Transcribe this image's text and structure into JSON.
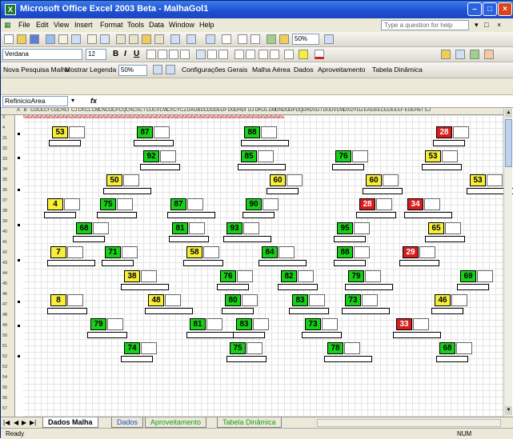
{
  "window": {
    "title": "Microsoft Office Excel 2003 Beta - MalhaGol1",
    "app_icon_label": "X"
  },
  "menu": {
    "items": [
      "File",
      "Edit",
      "View",
      "Insert",
      "Format",
      "Tools",
      "Data",
      "Window",
      "Help"
    ],
    "help_placeholder": "Type a question for help"
  },
  "standard_toolbar": {
    "zoom": "50%"
  },
  "formatting_toolbar": {
    "font": "Verdana",
    "size": "12",
    "bold": "B",
    "italic": "I",
    "underline": "U"
  },
  "custom_toolbar": {
    "items": [
      "Nova Pesquisa Malha",
      "Mostrar Legenda",
      "Configurações Gerais",
      "Malha Aérea",
      "Dados",
      "Aproveitamento",
      "Tabela Dinâmica"
    ],
    "zoom": "50%"
  },
  "formula_bar": {
    "name_box": "RefinicioArea",
    "fx": "fx",
    "content": ""
  },
  "row_numbers": [
    "3",
    "4",
    "31",
    "32",
    "33",
    "34",
    "35",
    "36",
    "37",
    "38",
    "39",
    "40",
    "41",
    "42",
    "43",
    "44",
    "45",
    "46",
    "47",
    "48",
    "49",
    "50",
    "51",
    "52",
    "53",
    "54",
    "55",
    "56",
    "57"
  ],
  "tiles": [
    {
      "v": "53",
      "c": "y"
    },
    {
      "v": "87",
      "c": "g"
    },
    {
      "v": "88",
      "c": "g"
    },
    {
      "v": "28",
      "c": "r"
    },
    {
      "v": "92",
      "c": "g"
    },
    {
      "v": "85",
      "c": "g"
    },
    {
      "v": "76",
      "c": "g"
    },
    {
      "v": "53",
      "c": "y"
    },
    {
      "v": "50",
      "c": "y"
    },
    {
      "v": "60",
      "c": "y"
    },
    {
      "v": "60",
      "c": "y"
    },
    {
      "v": "53",
      "c": "y"
    },
    {
      "v": "4",
      "c": "y"
    },
    {
      "v": "75",
      "c": "g"
    },
    {
      "v": "87",
      "c": "g"
    },
    {
      "v": "90",
      "c": "g"
    },
    {
      "v": "28",
      "c": "r"
    },
    {
      "v": "34",
      "c": "r"
    },
    {
      "v": "68",
      "c": "g"
    },
    {
      "v": "81",
      "c": "g"
    },
    {
      "v": "93",
      "c": "g"
    },
    {
      "v": "95",
      "c": "g"
    },
    {
      "v": "65",
      "c": "y"
    },
    {
      "v": "7",
      "c": "y"
    },
    {
      "v": "71",
      "c": "g"
    },
    {
      "v": "58",
      "c": "y"
    },
    {
      "v": "84",
      "c": "g"
    },
    {
      "v": "88",
      "c": "g"
    },
    {
      "v": "29",
      "c": "r"
    },
    {
      "v": "38",
      "c": "y"
    },
    {
      "v": "76",
      "c": "g"
    },
    {
      "v": "82",
      "c": "g"
    },
    {
      "v": "79",
      "c": "g"
    },
    {
      "v": "69",
      "c": "g"
    },
    {
      "v": "8",
      "c": "y"
    },
    {
      "v": "48",
      "c": "y"
    },
    {
      "v": "80",
      "c": "g"
    },
    {
      "v": "83",
      "c": "g"
    },
    {
      "v": "73",
      "c": "g"
    },
    {
      "v": "46",
      "c": "y"
    },
    {
      "v": "79",
      "c": "g"
    },
    {
      "v": "81",
      "c": "g"
    },
    {
      "v": "83",
      "c": "g"
    },
    {
      "v": "73",
      "c": "g"
    },
    {
      "v": "33",
      "c": "r"
    },
    {
      "v": "74",
      "c": "g"
    },
    {
      "v": "75",
      "c": "g"
    },
    {
      "v": "78",
      "c": "g"
    },
    {
      "v": "68",
      "c": "g"
    }
  ],
  "sheet_tabs": [
    "Dados Malha",
    "Dados",
    "Aproveitamento",
    "Tabela Dinâmica"
  ],
  "status": {
    "left": "Ready",
    "right": "NUM"
  },
  "colors": {
    "green": "#18d018",
    "yellow": "#f6ee38",
    "red": "#d91c1c",
    "title": "#1d4fd1"
  }
}
